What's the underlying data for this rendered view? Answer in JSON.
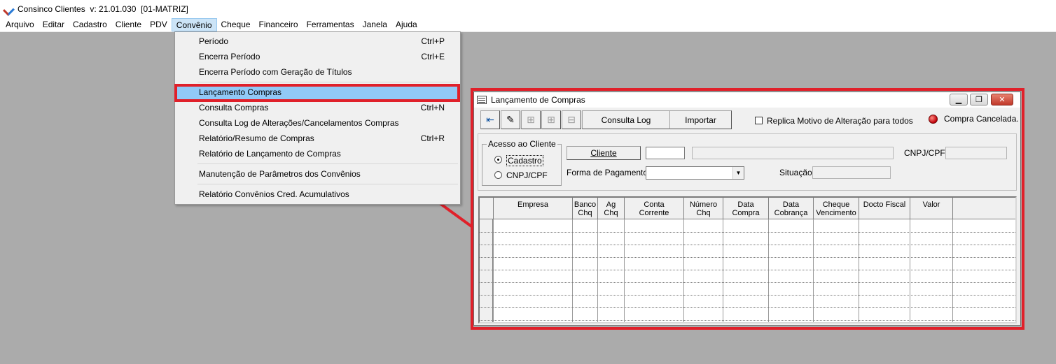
{
  "app": {
    "title": "Consinco Clientes  v: 21.01.030  [01-MATRIZ]"
  },
  "menubar": {
    "items": [
      "Arquivo",
      "Editar",
      "Cadastro",
      "Cliente",
      "PDV",
      "Convênio",
      "Cheque",
      "Financeiro",
      "Ferramentas",
      "Janela",
      "Ajuda"
    ],
    "active": "Convênio"
  },
  "dropdown": {
    "items": [
      {
        "label": "Período",
        "shortcut": "Ctrl+P"
      },
      {
        "label": "Encerra Período",
        "shortcut": "Ctrl+E"
      },
      {
        "label": "Encerra Período com Geração de Títulos",
        "shortcut": ""
      },
      {
        "label": "Lançamento Compras",
        "shortcut": ""
      },
      {
        "label": "Consulta Compras",
        "shortcut": "Ctrl+N"
      },
      {
        "label": "Consulta Log de Alterações/Cancelamentos Compras",
        "shortcut": ""
      },
      {
        "label": "Relatório/Resumo de Compras",
        "shortcut": "Ctrl+R"
      },
      {
        "label": "Relatório de Lançamento de Compras",
        "shortcut": ""
      },
      {
        "label": "Manutenção de Parâmetros dos Convênios",
        "shortcut": ""
      },
      {
        "label": "Relatório Convênios Cred. Acumulativos",
        "shortcut": ""
      }
    ]
  },
  "child_window": {
    "title": "Lançamento de Compras",
    "toolbar": {
      "consulta_log": "Consulta Log",
      "importar": "Importar"
    },
    "replica_checkbox": "Replica Motivo de Alteração para todos",
    "status_label": "Compra Cancelada.",
    "acesso": {
      "legend": "Acesso ao Cliente",
      "option_cadastro": "Cadastro",
      "option_cnpj": "CNPJ/CPF"
    },
    "form": {
      "cliente_button": "Cliente",
      "cnpj_label": "CNPJ/CPF",
      "forma_pagamento_label": "Forma de Pagamento",
      "situacao_label": "Situação"
    },
    "grid": {
      "columns": [
        [
          "Empresa"
        ],
        [
          "Banco",
          "Chq"
        ],
        [
          "Ag",
          "Chq"
        ],
        [
          "Conta",
          "Corrente"
        ],
        [
          "Número",
          "Chq"
        ],
        [
          "Data",
          "Compra"
        ],
        [
          "Data",
          "Cobrança"
        ],
        [
          "Cheque",
          "Vencimento"
        ],
        [
          "Docto Fiscal"
        ],
        [
          "Valor"
        ]
      ]
    }
  },
  "colors": {
    "highlight_box": "#e0202a",
    "menu_hover": "#91c9f7"
  }
}
